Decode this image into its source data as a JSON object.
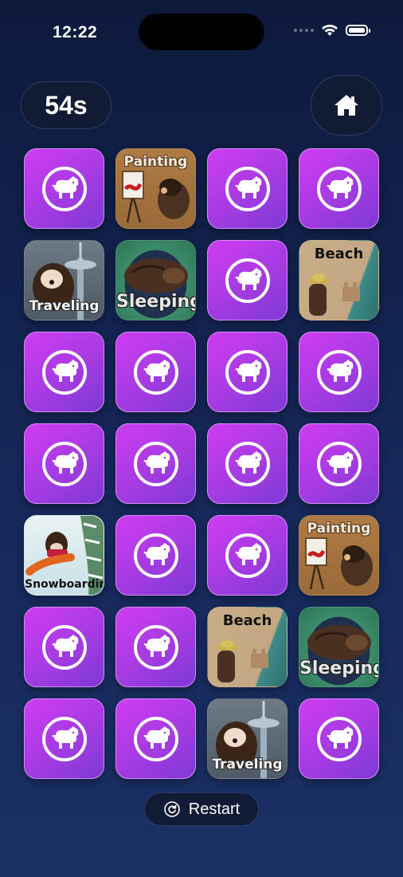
{
  "status_bar": {
    "time": "12:22"
  },
  "timer": {
    "value": "54s"
  },
  "restart": {
    "label": "Restart"
  },
  "theme": {
    "card_back_color": "#b23de6",
    "background": "#13234e"
  },
  "cards": [
    {
      "state": "hidden"
    },
    {
      "state": "revealed",
      "label": "Painting",
      "kind": "painting"
    },
    {
      "state": "hidden"
    },
    {
      "state": "hidden"
    },
    {
      "state": "revealed",
      "label": "Traveling",
      "kind": "traveling"
    },
    {
      "state": "revealed",
      "label": "Sleeping",
      "kind": "sleeping"
    },
    {
      "state": "hidden"
    },
    {
      "state": "revealed",
      "label": "Beach",
      "kind": "beach"
    },
    {
      "state": "hidden"
    },
    {
      "state": "hidden"
    },
    {
      "state": "hidden"
    },
    {
      "state": "hidden"
    },
    {
      "state": "hidden"
    },
    {
      "state": "hidden"
    },
    {
      "state": "hidden"
    },
    {
      "state": "hidden"
    },
    {
      "state": "revealed",
      "label": "Snowboarding",
      "kind": "snowboarding"
    },
    {
      "state": "hidden"
    },
    {
      "state": "hidden"
    },
    {
      "state": "revealed",
      "label": "Painting",
      "kind": "painting"
    },
    {
      "state": "hidden"
    },
    {
      "state": "hidden"
    },
    {
      "state": "revealed",
      "label": "Beach",
      "kind": "beach"
    },
    {
      "state": "revealed",
      "label": "Sleeping",
      "kind": "sleeping"
    },
    {
      "state": "hidden"
    },
    {
      "state": "hidden"
    },
    {
      "state": "revealed",
      "label": "Traveling",
      "kind": "traveling"
    },
    {
      "state": "hidden"
    }
  ]
}
